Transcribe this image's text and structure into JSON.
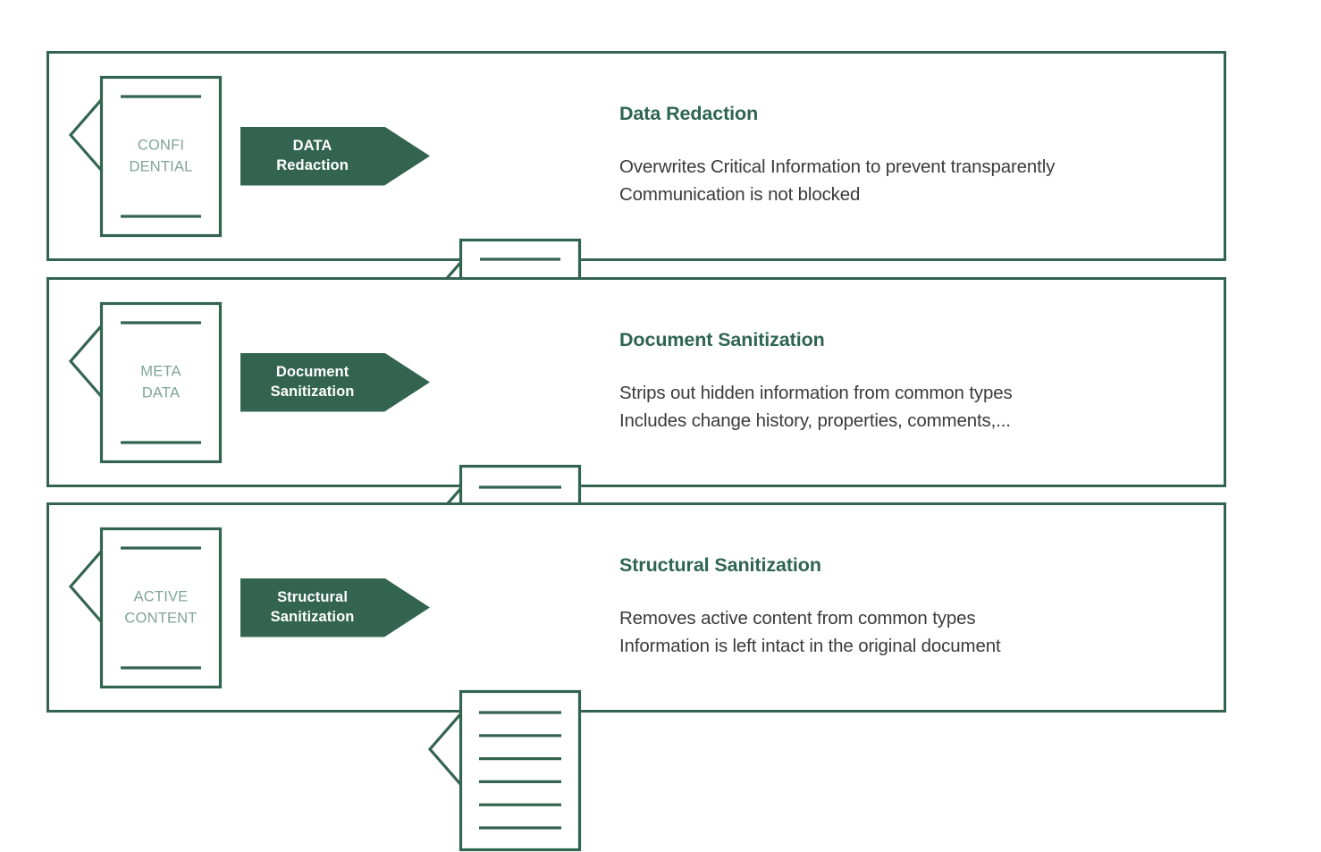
{
  "theme": {
    "green_dark": "#336450",
    "green_title": "#2e6550",
    "green_light": "#7fa495",
    "text_body": "#3b3b3b",
    "white": "#ffffff",
    "background": "#ffffff"
  },
  "rows": [
    {
      "id": "data-redaction",
      "source_doc": {
        "icon": "document-confidential-icon",
        "label_lines": [
          "CONFI",
          "DENTIAL"
        ],
        "top_rule": true,
        "bottom_rule": true,
        "body_lines": 0,
        "stars": []
      },
      "arrow": {
        "icon": "process-arrow-icon",
        "label_lines": [
          "DATA",
          "Redaction"
        ]
      },
      "result_doc": {
        "icon": "document-redacted-icon",
        "label_lines": [],
        "top_rule": true,
        "bottom_rule": true,
        "body_lines": 0,
        "stars": [
          "******",
          "******",
          "******"
        ]
      },
      "title": "Data Redaction",
      "description_lines": [
        "Overwrites Critical Information to prevent transparently",
        "Communication is not blocked"
      ]
    },
    {
      "id": "document-sanitization",
      "source_doc": {
        "icon": "document-metadata-icon",
        "label_lines": [
          "META",
          "DATA"
        ],
        "top_rule": true,
        "bottom_rule": true,
        "body_lines": 0,
        "stars": []
      },
      "arrow": {
        "icon": "process-arrow-icon",
        "label_lines": [
          "Document",
          "Sanitization"
        ]
      },
      "result_doc": {
        "icon": "document-clean-icon",
        "label_lines": [],
        "top_rule": false,
        "bottom_rule": false,
        "body_lines": 6,
        "stars": []
      },
      "title": "Document Sanitization",
      "description_lines": [
        "Strips out hidden information from common types",
        "Includes change history, properties, comments,..."
      ]
    },
    {
      "id": "structural-sanitization",
      "source_doc": {
        "icon": "document-active-content-icon",
        "label_lines": [
          "ACTIVE",
          "CONTENT"
        ],
        "top_rule": true,
        "bottom_rule": true,
        "body_lines": 0,
        "stars": []
      },
      "arrow": {
        "icon": "process-arrow-icon",
        "label_lines": [
          "Structural",
          "Sanitization"
        ]
      },
      "result_doc": {
        "icon": "document-clean-icon",
        "label_lines": [],
        "top_rule": false,
        "bottom_rule": false,
        "body_lines": 6,
        "stars": []
      },
      "title": "Structural Sanitization",
      "description_lines": [
        "Removes active content from common types",
        "Information is left intact in the original document"
      ]
    }
  ]
}
